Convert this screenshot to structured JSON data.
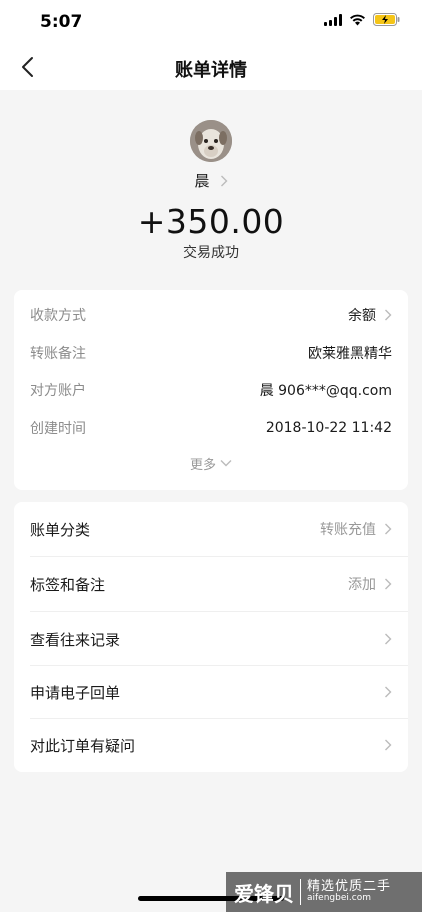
{
  "status_bar": {
    "time": "5:07"
  },
  "nav": {
    "title": "账单详情",
    "back_icon": "back-chevron-icon"
  },
  "header": {
    "payer_name": "晨",
    "amount": "+350.00",
    "status": "交易成功"
  },
  "details": {
    "rows": [
      {
        "label": "收款方式",
        "value": "余额",
        "has_arrow": true
      },
      {
        "label": "转账备注",
        "value": "欧莱雅黑精华",
        "has_arrow": false
      },
      {
        "label": "对方账户",
        "value": "晨 906***@qq.com",
        "has_arrow": false
      },
      {
        "label": "创建时间",
        "value": "2018-10-22 11:42",
        "has_arrow": false
      }
    ],
    "more_label": "更多"
  },
  "menu": {
    "items": [
      {
        "label": "账单分类",
        "value": "转账充值"
      },
      {
        "label": "标签和备注",
        "value": "添加"
      },
      {
        "label": "查看往来记录",
        "value": ""
      },
      {
        "label": "申请电子回单",
        "value": ""
      },
      {
        "label": "对此订单有疑问",
        "value": ""
      }
    ]
  },
  "watermark": {
    "brand": "爱锋贝",
    "slogan": "精选优质二手",
    "url": "aifengbei.com"
  },
  "colors": {
    "background": "#f5f5f5",
    "card": "#ffffff",
    "label_gray": "#8c8c8c",
    "text_dark": "#1a1a1a"
  }
}
